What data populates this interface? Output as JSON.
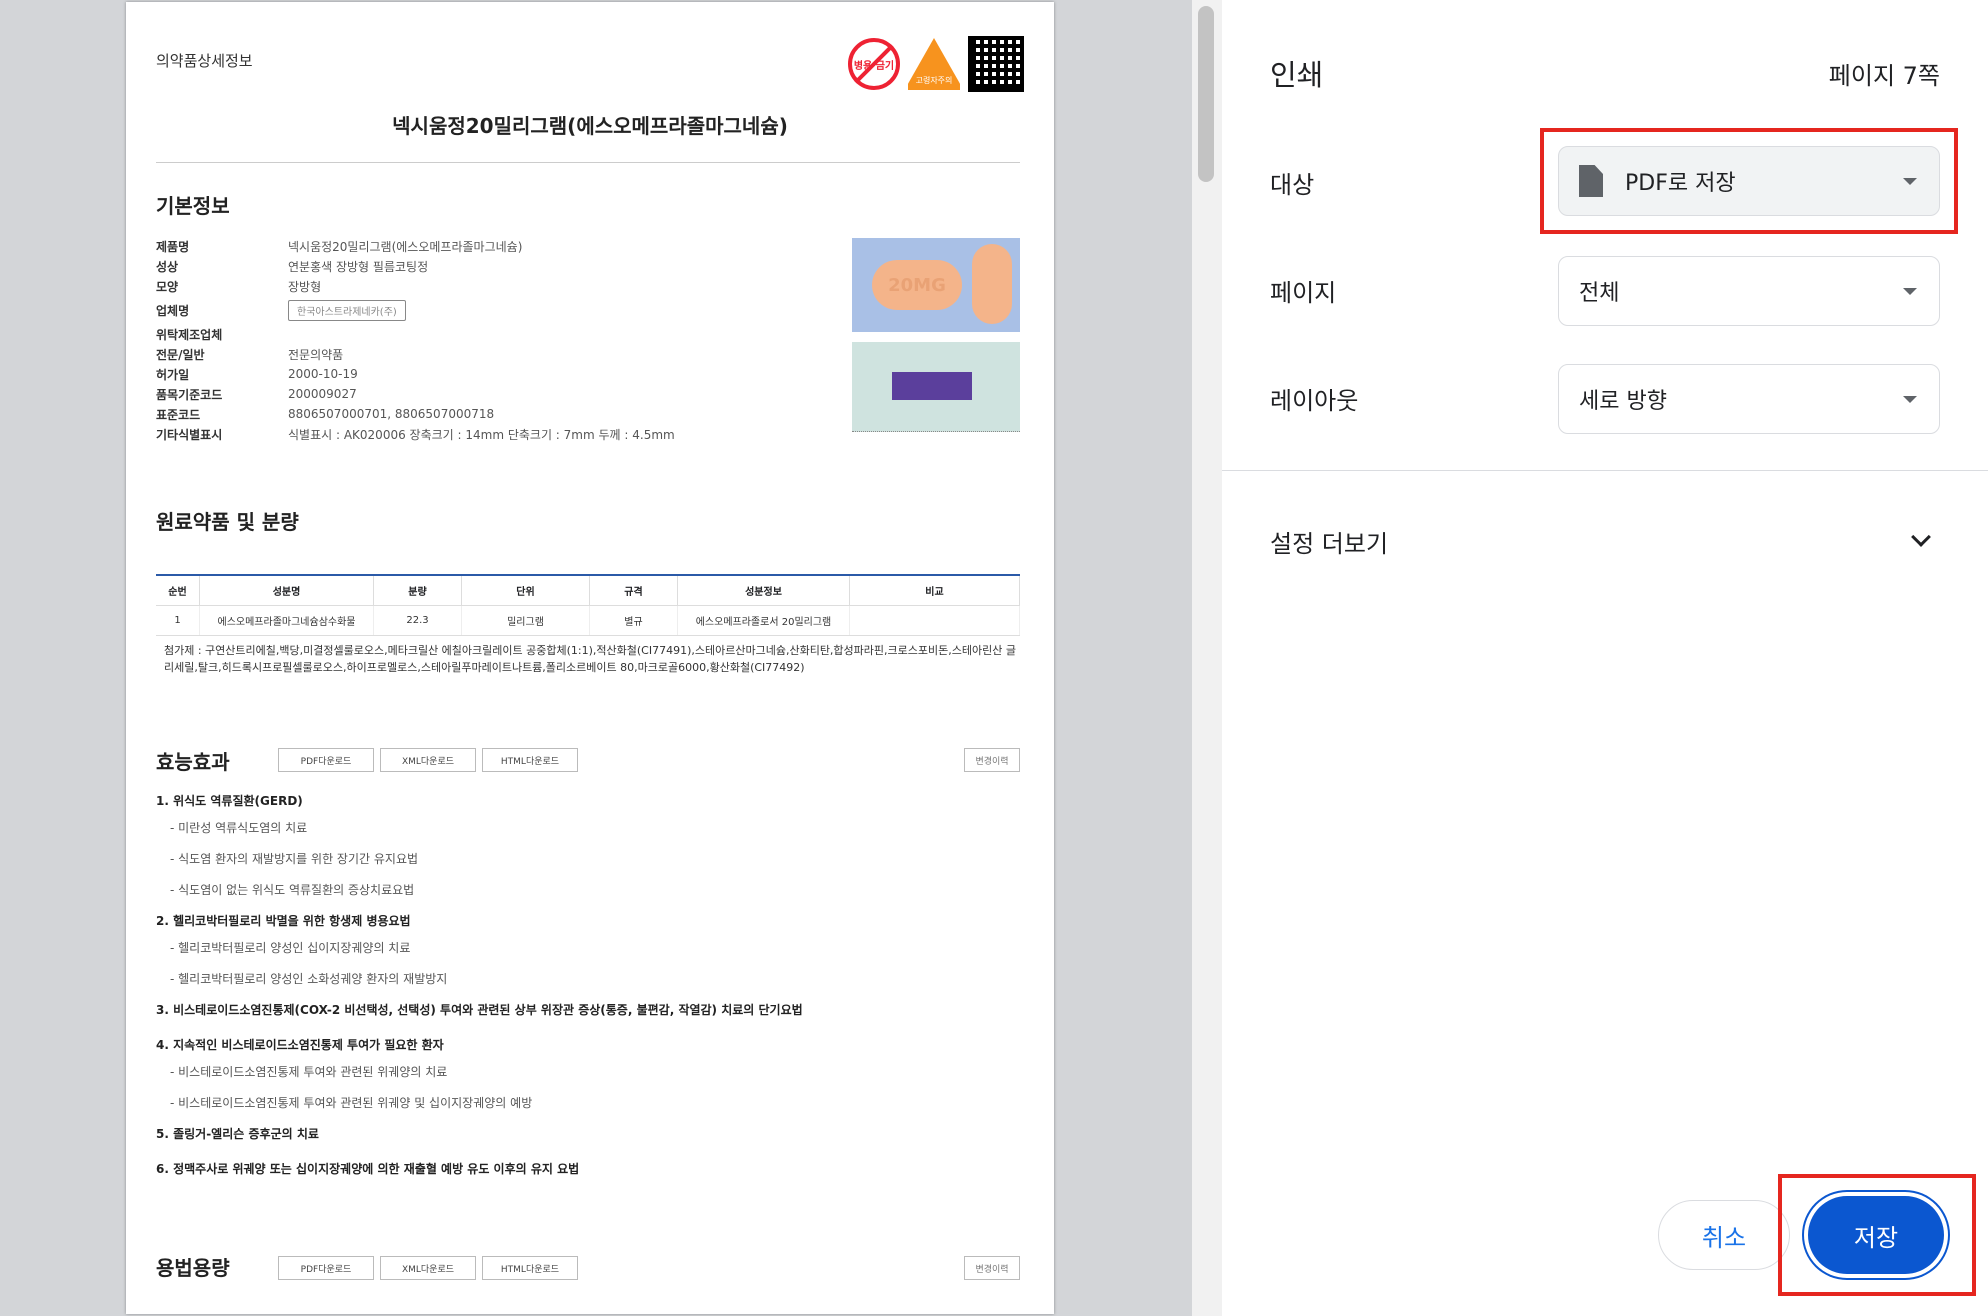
{
  "document": {
    "category_label": "의약품상세정보",
    "badge1_text": "병용 금기",
    "badge2_text": "고령자주의",
    "title": "넥시움정20밀리그램(에스오메프라졸마그네슘)",
    "basic_info": {
      "heading": "기본정보",
      "rows": [
        {
          "key": "제품명",
          "value": "넥시움정20밀리그램(에스오메프라졸마그네슘)"
        },
        {
          "key": "성상",
          "value": "연분홍색 장방형 필름코팅정"
        },
        {
          "key": "모양",
          "value": "장방형"
        },
        {
          "key": "업체명",
          "value": "한국아스트라제네카(주)"
        },
        {
          "key": "위탁제조업체",
          "value": ""
        },
        {
          "key": "전문/일반",
          "value": "전문의약품"
        },
        {
          "key": "허가일",
          "value": "2000-10-19"
        },
        {
          "key": "품목기준코드",
          "value": "200009027"
        },
        {
          "key": "표준코드",
          "value": "8806507000701, 8806507000718"
        },
        {
          "key": "기타식별표시",
          "value": "식별표시 : AK020006 장축크기 : 14mm 단축크기 : 7mm 두께 : 4.5mm"
        }
      ],
      "pill_imprint": "20MG"
    },
    "ingredients": {
      "heading": "원료약품 및 분량",
      "columns": [
        "순번",
        "성분명",
        "분량",
        "단위",
        "규격",
        "성분정보",
        "비교"
      ],
      "rows": [
        [
          "1",
          "에스오메프라졸마그네슘삼수화물",
          "22.3",
          "밀리그램",
          "별규",
          "에스오메프라졸로서 20밀리그램",
          ""
        ]
      ],
      "excipients": "첨가제 : 구연산트리에칠,백당,미결정셀룰로오스,메타크릴산 에칠아크릴레이트 공중합체(1:1),적산화철(CI77491),스테아르산마그네슘,산화티탄,합성파라핀,크로스포비돈,스테아린산 글리세릴,탈크,히드록시프로필셀룰로오스,하이프로멜로스,스테아릴푸마레이트나트륨,폴리소르베이트 80,마크로골6000,황산화철(CI77492)"
    },
    "efficacy": {
      "heading": "효능효과",
      "items": [
        {
          "main": "1. 위식도 역류질환(GERD)",
          "subs": [
            "- 미란성 역류식도염의 치료",
            "- 식도염 환자의 재발방지를 위한 장기간 유지요법",
            "- 식도염이 없는 위식도 역류질환의 증상치료요법"
          ]
        },
        {
          "main": "2. 헬리코박터필로리 박멸을 위한 항생제 병용요법",
          "subs": [
            "- 헬리코박터필로리 양성인 십이지장궤양의 치료",
            "- 헬리코박터필로리 양성인 소화성궤양 환자의 재발방지"
          ]
        },
        {
          "main": "3. 비스테로이드소염진통제(COX-2 비선택성, 선택성) 투여와 관련된 상부 위장관 증상(통증, 불편감, 작열감) 치료의 단기요법",
          "subs": []
        },
        {
          "main": "4. 지속적인 비스테로이드소염진통제 투여가 필요한 환자",
          "subs": [
            "- 비스테로이드소염진통제 투여와 관련된 위궤양의 치료",
            "- 비스테로이드소염진통제 투여와 관련된 위궤양 및 십이지장궤양의 예방"
          ]
        },
        {
          "main": "5. 졸링거-엘리슨 증후군의 치료",
          "subs": []
        },
        {
          "main": "6. 정맥주사로 위궤양 또는 십이지장궤양에 의한 재출혈 예방 유도 이후의 유지 요법",
          "subs": []
        }
      ]
    },
    "dosage": {
      "heading": "용법용량"
    },
    "download_buttons": [
      "PDF다운로드",
      "XML다운로드",
      "HTML다운로드"
    ],
    "history_button": "변경이력"
  },
  "print_panel": {
    "title": "인쇄",
    "page_count": "페이지 7쪽",
    "destination": {
      "label": "대상",
      "value": "PDF로 저장"
    },
    "pages": {
      "label": "페이지",
      "value": "전체"
    },
    "layout": {
      "label": "레이아웃",
      "value": "세로 방향"
    },
    "more_settings": "설정 더보기",
    "cancel_label": "취소",
    "save_label": "저장"
  },
  "colors": {
    "accent": "#0b57d0",
    "highlight": "#e5261f",
    "link": "#1a73e8"
  }
}
